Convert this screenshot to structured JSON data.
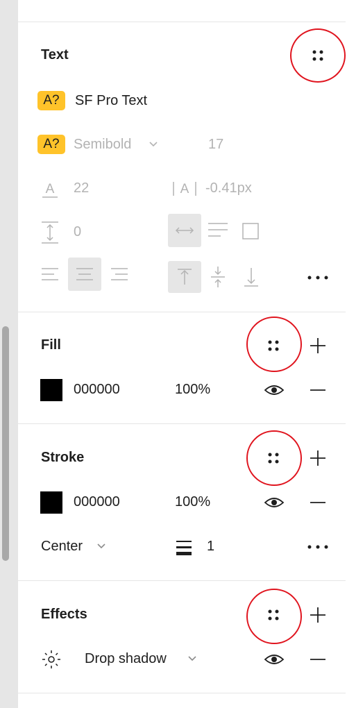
{
  "text_section": {
    "title": "Text",
    "font_badge": "A?",
    "font_family": "SF Pro Text",
    "weight_badge": "A?",
    "font_weight": "Semibold",
    "font_size": "17",
    "line_height": "22",
    "letter_spacing": "-0.41px",
    "paragraph_spacing": "0"
  },
  "fill_section": {
    "title": "Fill",
    "color_hex": "000000",
    "opacity": "100%"
  },
  "stroke_section": {
    "title": "Stroke",
    "color_hex": "000000",
    "opacity": "100%",
    "position": "Center",
    "weight": "1"
  },
  "effects_section": {
    "title": "Effects",
    "effect_type": "Drop shadow"
  },
  "colors": {
    "badge": "#ffc32a",
    "annotation_ring": "#e0141e",
    "active_button_bg": "#e6e6e6"
  }
}
